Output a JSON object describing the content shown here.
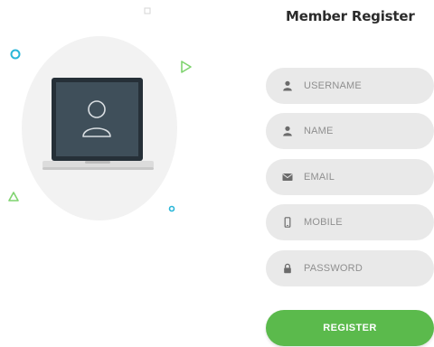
{
  "form": {
    "title": "Member Register",
    "fields": [
      {
        "icon": "user-icon",
        "placeholder": "USERNAME",
        "value": ""
      },
      {
        "icon": "user-icon",
        "placeholder": "NAME",
        "value": ""
      },
      {
        "icon": "envelope-icon",
        "placeholder": "EMAIL",
        "value": ""
      },
      {
        "icon": "mobile-phone-icon",
        "placeholder": "MOBILE",
        "value": ""
      },
      {
        "icon": "lock-icon",
        "placeholder": "PASSWORD",
        "value": ""
      }
    ],
    "register_label": "REGISTER"
  },
  "colors": {
    "accent": "#5bba4c",
    "field_background": "#e9e9e9",
    "illustration_circle": "#f2f2f2",
    "laptop_screen": "#3f4f5a",
    "decor_cyan": "#29b6d8",
    "decor_green": "#7fd36f"
  }
}
